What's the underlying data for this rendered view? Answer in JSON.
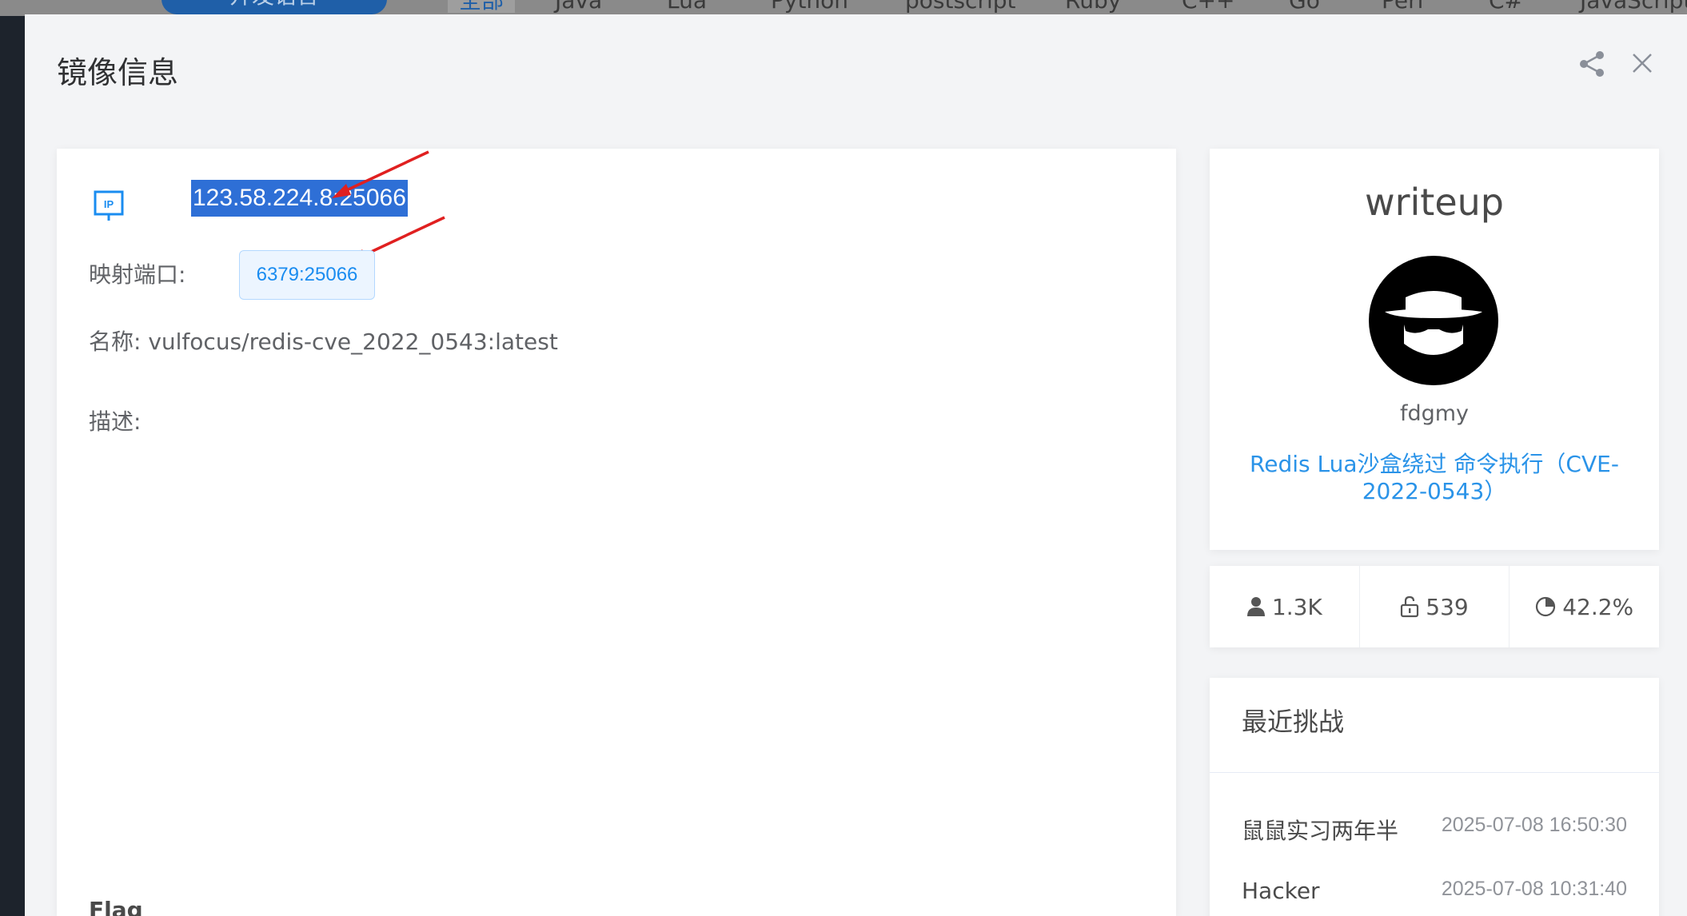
{
  "background_nav": {
    "pill_label": "开发语言",
    "tabs": [
      "全部",
      "Java",
      "Lua",
      "Python",
      "postscript",
      "Ruby",
      "C++",
      "Go",
      "Perl",
      "C#",
      "JavaScript"
    ]
  },
  "modal": {
    "title": "镜像信息",
    "icons": {
      "share": "share-icon",
      "close": "close-icon"
    }
  },
  "main": {
    "ip_icon_label": "IP",
    "ip_address": "123.58.224.8:25066",
    "port_label": "映射端口:",
    "port_value": "6379:25066",
    "name_row": "名称: vulfocus/redis-cve_2022_0543:latest",
    "desc_label": "描述:",
    "flag_label": "Flag"
  },
  "writeup": {
    "title": "writeup",
    "author": "fdgmy",
    "link_text": "Redis Lua沙盒绕过 命令执行（CVE-2022-0543）"
  },
  "stats": {
    "users": "1.3K",
    "unlocked": "539",
    "rate": "42.2%"
  },
  "recent": {
    "title": "最近挑战",
    "items": [
      {
        "name": "鼠鼠实习两年半",
        "time": "2025-07-08 16:50:30"
      },
      {
        "name": "Hacker",
        "time": "2025-07-08 10:31:40"
      }
    ]
  },
  "colors": {
    "accent": "#2a93e8",
    "selection": "#2e6fd6",
    "arrow": "#e02020"
  }
}
